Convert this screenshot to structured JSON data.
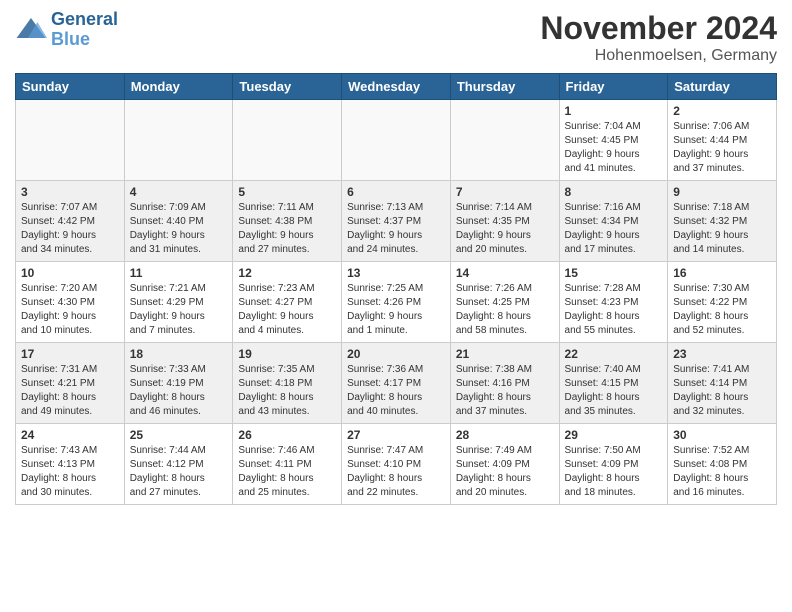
{
  "header": {
    "logo_line1": "General",
    "logo_line2": "Blue",
    "month": "November 2024",
    "location": "Hohenmoelsen, Germany"
  },
  "weekdays": [
    "Sunday",
    "Monday",
    "Tuesday",
    "Wednesday",
    "Thursday",
    "Friday",
    "Saturday"
  ],
  "weeks": [
    [
      {
        "day": "",
        "info": "",
        "empty": true
      },
      {
        "day": "",
        "info": "",
        "empty": true
      },
      {
        "day": "",
        "info": "",
        "empty": true
      },
      {
        "day": "",
        "info": "",
        "empty": true
      },
      {
        "day": "",
        "info": "",
        "empty": true
      },
      {
        "day": "1",
        "info": "Sunrise: 7:04 AM\nSunset: 4:45 PM\nDaylight: 9 hours\nand 41 minutes."
      },
      {
        "day": "2",
        "info": "Sunrise: 7:06 AM\nSunset: 4:44 PM\nDaylight: 9 hours\nand 37 minutes."
      }
    ],
    [
      {
        "day": "3",
        "info": "Sunrise: 7:07 AM\nSunset: 4:42 PM\nDaylight: 9 hours\nand 34 minutes."
      },
      {
        "day": "4",
        "info": "Sunrise: 7:09 AM\nSunset: 4:40 PM\nDaylight: 9 hours\nand 31 minutes."
      },
      {
        "day": "5",
        "info": "Sunrise: 7:11 AM\nSunset: 4:38 PM\nDaylight: 9 hours\nand 27 minutes."
      },
      {
        "day": "6",
        "info": "Sunrise: 7:13 AM\nSunset: 4:37 PM\nDaylight: 9 hours\nand 24 minutes."
      },
      {
        "day": "7",
        "info": "Sunrise: 7:14 AM\nSunset: 4:35 PM\nDaylight: 9 hours\nand 20 minutes."
      },
      {
        "day": "8",
        "info": "Sunrise: 7:16 AM\nSunset: 4:34 PM\nDaylight: 9 hours\nand 17 minutes."
      },
      {
        "day": "9",
        "info": "Sunrise: 7:18 AM\nSunset: 4:32 PM\nDaylight: 9 hours\nand 14 minutes."
      }
    ],
    [
      {
        "day": "10",
        "info": "Sunrise: 7:20 AM\nSunset: 4:30 PM\nDaylight: 9 hours\nand 10 minutes."
      },
      {
        "day": "11",
        "info": "Sunrise: 7:21 AM\nSunset: 4:29 PM\nDaylight: 9 hours\nand 7 minutes."
      },
      {
        "day": "12",
        "info": "Sunrise: 7:23 AM\nSunset: 4:27 PM\nDaylight: 9 hours\nand 4 minutes."
      },
      {
        "day": "13",
        "info": "Sunrise: 7:25 AM\nSunset: 4:26 PM\nDaylight: 9 hours\nand 1 minute."
      },
      {
        "day": "14",
        "info": "Sunrise: 7:26 AM\nSunset: 4:25 PM\nDaylight: 8 hours\nand 58 minutes."
      },
      {
        "day": "15",
        "info": "Sunrise: 7:28 AM\nSunset: 4:23 PM\nDaylight: 8 hours\nand 55 minutes."
      },
      {
        "day": "16",
        "info": "Sunrise: 7:30 AM\nSunset: 4:22 PM\nDaylight: 8 hours\nand 52 minutes."
      }
    ],
    [
      {
        "day": "17",
        "info": "Sunrise: 7:31 AM\nSunset: 4:21 PM\nDaylight: 8 hours\nand 49 minutes."
      },
      {
        "day": "18",
        "info": "Sunrise: 7:33 AM\nSunset: 4:19 PM\nDaylight: 8 hours\nand 46 minutes."
      },
      {
        "day": "19",
        "info": "Sunrise: 7:35 AM\nSunset: 4:18 PM\nDaylight: 8 hours\nand 43 minutes."
      },
      {
        "day": "20",
        "info": "Sunrise: 7:36 AM\nSunset: 4:17 PM\nDaylight: 8 hours\nand 40 minutes."
      },
      {
        "day": "21",
        "info": "Sunrise: 7:38 AM\nSunset: 4:16 PM\nDaylight: 8 hours\nand 37 minutes."
      },
      {
        "day": "22",
        "info": "Sunrise: 7:40 AM\nSunset: 4:15 PM\nDaylight: 8 hours\nand 35 minutes."
      },
      {
        "day": "23",
        "info": "Sunrise: 7:41 AM\nSunset: 4:14 PM\nDaylight: 8 hours\nand 32 minutes."
      }
    ],
    [
      {
        "day": "24",
        "info": "Sunrise: 7:43 AM\nSunset: 4:13 PM\nDaylight: 8 hours\nand 30 minutes."
      },
      {
        "day": "25",
        "info": "Sunrise: 7:44 AM\nSunset: 4:12 PM\nDaylight: 8 hours\nand 27 minutes."
      },
      {
        "day": "26",
        "info": "Sunrise: 7:46 AM\nSunset: 4:11 PM\nDaylight: 8 hours\nand 25 minutes."
      },
      {
        "day": "27",
        "info": "Sunrise: 7:47 AM\nSunset: 4:10 PM\nDaylight: 8 hours\nand 22 minutes."
      },
      {
        "day": "28",
        "info": "Sunrise: 7:49 AM\nSunset: 4:09 PM\nDaylight: 8 hours\nand 20 minutes."
      },
      {
        "day": "29",
        "info": "Sunrise: 7:50 AM\nSunset: 4:09 PM\nDaylight: 8 hours\nand 18 minutes."
      },
      {
        "day": "30",
        "info": "Sunrise: 7:52 AM\nSunset: 4:08 PM\nDaylight: 8 hours\nand 16 minutes."
      }
    ]
  ]
}
